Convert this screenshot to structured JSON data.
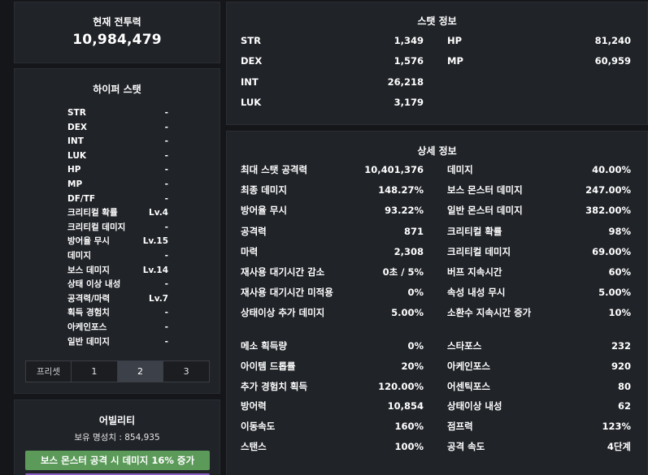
{
  "power": {
    "title": "현재 전투력",
    "value": "10,984,479"
  },
  "hyper": {
    "title": "하이퍼 스탯",
    "rows": [
      {
        "name": "STR",
        "value": "-"
      },
      {
        "name": "DEX",
        "value": "-"
      },
      {
        "name": "INT",
        "value": "-"
      },
      {
        "name": "LUK",
        "value": "-"
      },
      {
        "name": "HP",
        "value": "-"
      },
      {
        "name": "MP",
        "value": "-"
      },
      {
        "name": "DF/TF",
        "value": "-"
      },
      {
        "name": "크리티컬 확률",
        "value": "Lv.4"
      },
      {
        "name": "크리티컬 데미지",
        "value": "-"
      },
      {
        "name": "방어율 무시",
        "value": "Lv.15"
      },
      {
        "name": "데미지",
        "value": "-"
      },
      {
        "name": "보스 데미지",
        "value": "Lv.14"
      },
      {
        "name": "상태 이상 내성",
        "value": "-"
      },
      {
        "name": "공격력/마력",
        "value": "Lv.7"
      },
      {
        "name": "획득 경험치",
        "value": "-"
      },
      {
        "name": "아케인포스",
        "value": "-"
      },
      {
        "name": "일반 데미지",
        "value": "-"
      }
    ],
    "preset_label": "프리셋",
    "presets": [
      "1",
      "2",
      "3"
    ],
    "active_preset": "2"
  },
  "ability": {
    "title": "어빌리티",
    "honor": "보유 명성치 : 854,935",
    "lines": [
      "보스 몬스터 공격 시 데미지 16% 증가",
      ""
    ],
    "line_colors": [
      "#5c9a5a",
      "#8a5dc2"
    ]
  },
  "stats": {
    "title": "스탯 정보",
    "left": [
      {
        "name": "STR",
        "value": "1,349"
      },
      {
        "name": "DEX",
        "value": "1,576"
      },
      {
        "name": "INT",
        "value": "26,218"
      },
      {
        "name": "LUK",
        "value": "3,179"
      }
    ],
    "right": [
      {
        "name": "HP",
        "value": "81,240"
      },
      {
        "name": "MP",
        "value": "60,959"
      }
    ]
  },
  "detail": {
    "title": "상세 정보",
    "group1_left": [
      {
        "name": "최대 스탯 공격력",
        "value": "10,401,376"
      },
      {
        "name": "최종 데미지",
        "value": "148.27%"
      },
      {
        "name": "방어율 무시",
        "value": "93.22%"
      },
      {
        "name": "공격력",
        "value": "871"
      },
      {
        "name": "마력",
        "value": "2,308"
      },
      {
        "name": "재사용 대기시간 감소",
        "value": "0초 / 5%"
      },
      {
        "name": "재사용 대기시간 미적용",
        "value": "0%"
      },
      {
        "name": "상태이상 추가 데미지",
        "value": "5.00%"
      }
    ],
    "group1_right": [
      {
        "name": "데미지",
        "value": "40.00%"
      },
      {
        "name": "보스 몬스터 데미지",
        "value": "247.00%"
      },
      {
        "name": "일반 몬스터 데미지",
        "value": "382.00%"
      },
      {
        "name": "크리티컬 확률",
        "value": "98%"
      },
      {
        "name": "크리티컬 데미지",
        "value": "69.00%"
      },
      {
        "name": "버프 지속시간",
        "value": "60%"
      },
      {
        "name": "속성 내성 무시",
        "value": "5.00%"
      },
      {
        "name": "소환수 지속시간 증가",
        "value": "10%"
      }
    ],
    "group2_left": [
      {
        "name": "메소 획득량",
        "value": "0%"
      },
      {
        "name": "아이템 드롭률",
        "value": "20%"
      },
      {
        "name": "추가 경험치 획득",
        "value": "120.00%"
      },
      {
        "name": "방어력",
        "value": "10,854"
      },
      {
        "name": "이동속도",
        "value": "160%"
      },
      {
        "name": "스탠스",
        "value": "100%"
      }
    ],
    "group2_right": [
      {
        "name": "스타포스",
        "value": "232"
      },
      {
        "name": "아케인포스",
        "value": "920"
      },
      {
        "name": "어센틱포스",
        "value": "80"
      },
      {
        "name": "상태이상 내성",
        "value": "62"
      },
      {
        "name": "점프력",
        "value": "123%"
      },
      {
        "name": "공격 속도",
        "value": "4단계"
      }
    ]
  }
}
